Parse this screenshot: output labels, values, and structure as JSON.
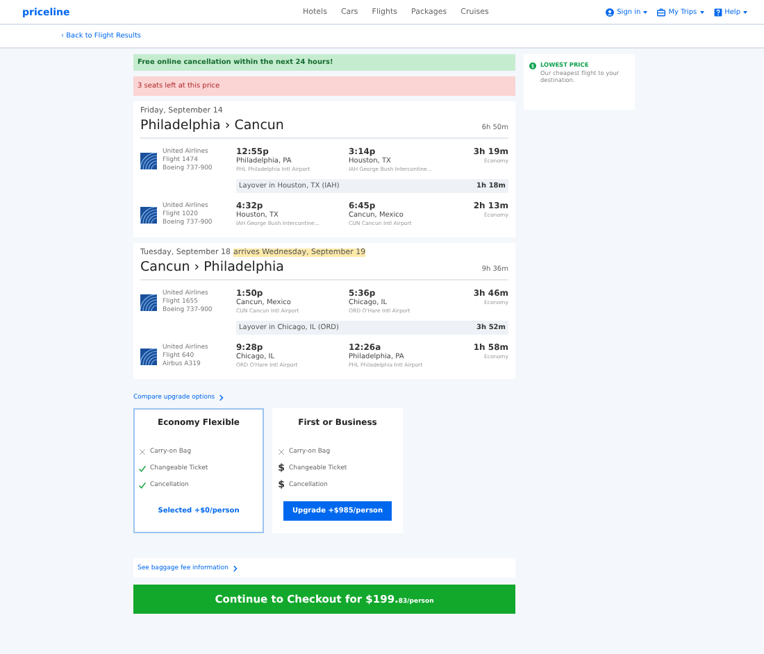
{
  "header": {
    "logo": "priceline",
    "nav": [
      "Hotels",
      "Cars",
      "Flights",
      "Packages",
      "Cruises"
    ],
    "account": [
      {
        "label": "Sign in",
        "kind": "user"
      },
      {
        "label": "My Trips",
        "kind": "suitcase"
      },
      {
        "label": "Help",
        "kind": "help"
      }
    ]
  },
  "back_link": "‹ Back to Flight Results",
  "notices": [
    {
      "text": "Free online cancellation within the next 24 hours!",
      "kind": "success"
    },
    {
      "text": "3 seats left at this price",
      "kind": "warning"
    }
  ],
  "aside": {
    "title": "LOWEST PRICE",
    "text": "Our cheapest flight to your destination."
  },
  "journeys": [
    {
      "date": "Friday, September 14",
      "route": "Philadelphia › Cancun",
      "duration": "6h 50m",
      "legs": [
        {
          "kind": "segment",
          "airline": "United Airlines",
          "flight": "Flight 1474",
          "aircraft": "Boeing 737-900",
          "depart_time": "12:55p",
          "depart_city": "Philadelphia, PA",
          "depart_airport": "PHL Philadelphia Intl Airport",
          "arrive_time": "3:14p",
          "arrive_city": "Houston, TX",
          "arrive_airport": "IAH George Bush Intercontine...",
          "duration": "3h 19m",
          "cabin": "Economy"
        },
        {
          "kind": "layover",
          "text": "Layover in Houston, TX (IAH)",
          "duration": "1h 18m"
        },
        {
          "kind": "segment",
          "airline": "United Airlines",
          "flight": "Flight 1020",
          "aircraft": "Boeing 737-900",
          "depart_time": "4:32p",
          "depart_city": "Houston, TX",
          "depart_airport": "IAH George Bush Intercontine...",
          "arrive_time": "6:45p",
          "arrive_city": "Cancun, Mexico",
          "arrive_airport": "CUN Cancun Intl Airport",
          "duration": "2h 13m",
          "cabin": "Economy"
        }
      ]
    },
    {
      "date": "Tuesday, September 18",
      "arrival_note": "arrives Wednesday, September 19",
      "route": "Cancun › Philadelphia",
      "duration": "9h 36m",
      "legs": [
        {
          "kind": "segment",
          "airline": "United Airlines",
          "flight": "Flight 1655",
          "aircraft": "Boeing 737-900",
          "depart_time": "1:50p",
          "depart_city": "Cancun, Mexico",
          "depart_airport": "CUN Cancun Intl Airport",
          "arrive_time": "5:36p",
          "arrive_city": "Chicago, IL",
          "arrive_airport": "ORD O'Hare Intl Airport",
          "duration": "3h 46m",
          "cabin": "Economy"
        },
        {
          "kind": "layover",
          "text": "Layover in Chicago, IL (ORD)",
          "duration": "3h 52m"
        },
        {
          "kind": "segment",
          "airline": "United Airlines",
          "flight": "Flight 640",
          "aircraft": "Airbus A319",
          "depart_time": "9:28p",
          "depart_city": "Chicago, IL",
          "depart_airport": "ORD O'Hare Intl Airport",
          "arrive_time": "12:26a",
          "arrive_city": "Philadelphia, PA",
          "arrive_airport": "PHL Philadelphia Intl Airport",
          "duration": "1h 58m",
          "cabin": "Economy"
        }
      ]
    }
  ],
  "upgrade": {
    "link": "Compare upgrade options",
    "options": [
      {
        "title": "Economy Flexible",
        "selected": true,
        "action": "Selected +$0/person",
        "features": [
          {
            "label": "Carry-on Bag",
            "kind": "excluded"
          },
          {
            "label": "Changeable Ticket",
            "kind": "included"
          },
          {
            "label": "Cancellation",
            "kind": "included"
          }
        ]
      },
      {
        "title": "First or Business",
        "selected": false,
        "action": "Upgrade +$985/person",
        "features": [
          {
            "label": "Carry-on Bag",
            "kind": "excluded"
          },
          {
            "label": "Changeable Ticket",
            "kind": "paid",
            "symbol": "$"
          },
          {
            "label": "Cancellation",
            "kind": "paid",
            "symbol": "$"
          }
        ]
      }
    ]
  },
  "baggage_link": "See baggage fee information",
  "checkout": {
    "label": "Continue to Checkout for $199.",
    "suffix": "83/person"
  }
}
